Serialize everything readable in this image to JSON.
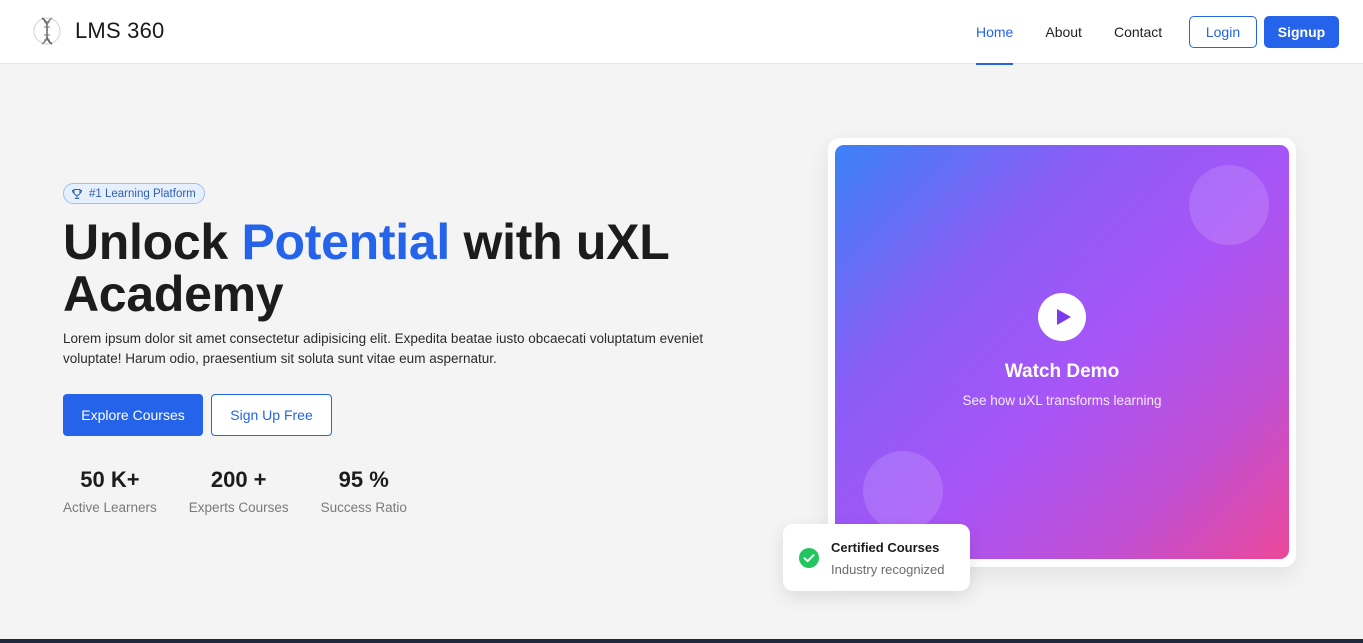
{
  "nav": {
    "brand": "LMS 360",
    "links": [
      {
        "label": "Home",
        "active": true
      },
      {
        "label": "About",
        "active": false
      },
      {
        "label": "Contact",
        "active": false
      }
    ],
    "login_label": "Login",
    "signup_label": "Signup"
  },
  "hero": {
    "badge": "#1 Learning Platform",
    "title_part1": "Unlock ",
    "title_accent": "Potential",
    "title_part2": " with uXL Academy",
    "description": "Lorem ipsum dolor sit amet consectetur adipisicing elit. Expedita beatae iusto obcaecati voluptatum eveniet voluptate! Harum odio, praesentium sit soluta sunt vitae eum aspernatur.",
    "explore_label": "Explore Courses",
    "signup_free_label": "Sign Up Free",
    "stats": [
      {
        "value": "50 K+",
        "label": "Active Learners"
      },
      {
        "value": "200 +",
        "label": "Experts Courses"
      },
      {
        "value": "95 %",
        "label": "Success Ratio"
      }
    ]
  },
  "video": {
    "title": "Watch Demo",
    "subtitle": "See how uXL transforms learning"
  },
  "certified": {
    "title": "Certified Courses",
    "subtitle": "Industry recognized"
  },
  "colors": {
    "accent": "#2563eb",
    "gradient_start": "#3b82f6",
    "gradient_mid": "#a855f7",
    "gradient_end": "#ec4899",
    "success": "#22c55e"
  },
  "icons": {
    "brand": "dna-helix-icon",
    "badge": "trophy-icon",
    "play": "play-icon",
    "certified": "check-circle-icon"
  }
}
